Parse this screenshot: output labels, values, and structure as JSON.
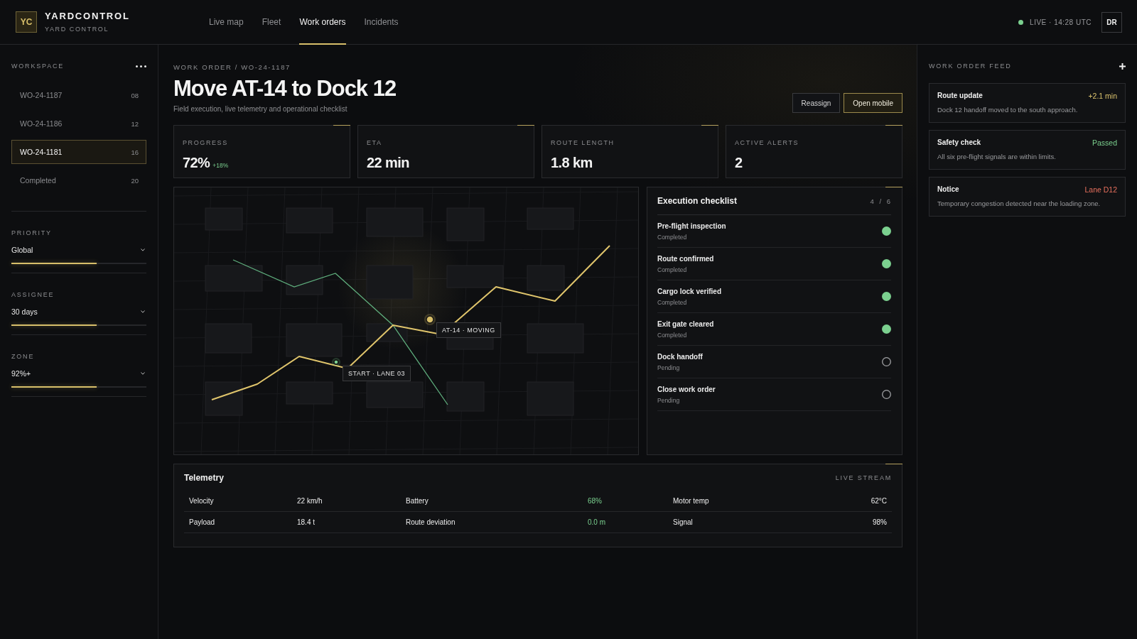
{
  "header": {
    "logo": "YC",
    "brand": "YARDCONTROL",
    "subtitle": "YARD CONTROL",
    "nav": [
      {
        "label": "Live map",
        "selected": false
      },
      {
        "label": "Fleet",
        "selected": false
      },
      {
        "label": "Work orders",
        "selected": true
      },
      {
        "label": "Incidents",
        "selected": false
      }
    ],
    "status": {
      "live": true,
      "text": "LIVE · 14:28 UTC"
    },
    "avatar": "DR"
  },
  "sidebar": {
    "title": "WORKSPACE",
    "items": [
      {
        "label": "WO-24-1187",
        "count": "08",
        "selected": false
      },
      {
        "label": "WO-24-1186",
        "count": "12",
        "selected": false
      },
      {
        "label": "WO-24-1181",
        "count": "16",
        "selected": true
      },
      {
        "label": "Completed",
        "count": "20",
        "selected": false
      }
    ],
    "filters": [
      {
        "label": "PRIORITY",
        "value": "Global",
        "level": 0.63
      },
      {
        "label": "ASSIGNEE",
        "value": "30 days",
        "level": 0.63
      },
      {
        "label": "ZONE",
        "value": "92%+",
        "level": 0.63
      }
    ]
  },
  "work_order": {
    "breadcrumb": "WORK ORDER / WO-24-1187",
    "title": "Move AT-14 to Dock 12",
    "subtitle": "Field execution, live telemetry and operational checklist",
    "actions": [
      {
        "label": "Reassign",
        "primary": false
      },
      {
        "label": "Open mobile",
        "primary": true
      }
    ]
  },
  "stats": [
    {
      "label": "PROGRESS",
      "value": "72%",
      "delta": "+18%"
    },
    {
      "label": "ETA",
      "value": "22 min"
    },
    {
      "label": "ROUTE LENGTH",
      "value": "1.8 km"
    },
    {
      "label": "ACTIVE ALERTS",
      "value": "2"
    }
  ],
  "map": {
    "markers": [
      {
        "kind": "vehicle",
        "label": "AT-14 · MOVING"
      },
      {
        "kind": "start",
        "label": "START · LANE 03"
      }
    ]
  },
  "checklist": {
    "title": "Execution checklist",
    "count": "4 / 6",
    "items": [
      {
        "name": "Pre-flight inspection",
        "status": "Completed",
        "done": true
      },
      {
        "name": "Route confirmed",
        "status": "Completed",
        "done": true
      },
      {
        "name": "Cargo lock verified",
        "status": "Completed",
        "done": true
      },
      {
        "name": "Exit gate cleared",
        "status": "Completed",
        "done": true
      },
      {
        "name": "Dock handoff",
        "status": "Pending",
        "done": false
      },
      {
        "name": "Close work order",
        "status": "Pending",
        "done": false
      }
    ]
  },
  "telemetry": {
    "title": "Telemetry",
    "badge": "LIVE STREAM",
    "rows": [
      {
        "cells": [
          {
            "label": "Velocity",
            "value": "22 km/h",
            "highlight": false
          },
          {
            "label": "Battery",
            "value": "68%",
            "highlight": true
          },
          {
            "label": "Motor temp",
            "value": "62°C",
            "highlight": false
          }
        ]
      },
      {
        "cells": [
          {
            "label": "Payload",
            "value": "18.4 t",
            "highlight": false
          },
          {
            "label": "Route deviation",
            "value": "0.0 m",
            "highlight": true
          },
          {
            "label": "Signal",
            "value": "98%",
            "highlight": false
          }
        ]
      }
    ]
  },
  "feed": {
    "title": "WORK ORDER FEED",
    "items": [
      {
        "title": "Route update",
        "tag": "+2.1 min",
        "color": "#dcc36e",
        "text": "Dock 12 handoff moved to the south approach."
      },
      {
        "title": "Safety check",
        "tag": "Passed",
        "color": "#7bcf8e",
        "text": "All six pre-flight signals are within limits."
      },
      {
        "title": "Notice",
        "tag": "Lane D12",
        "color": "#e8705e",
        "text": "Temporary congestion detected near the loading zone."
      }
    ]
  }
}
